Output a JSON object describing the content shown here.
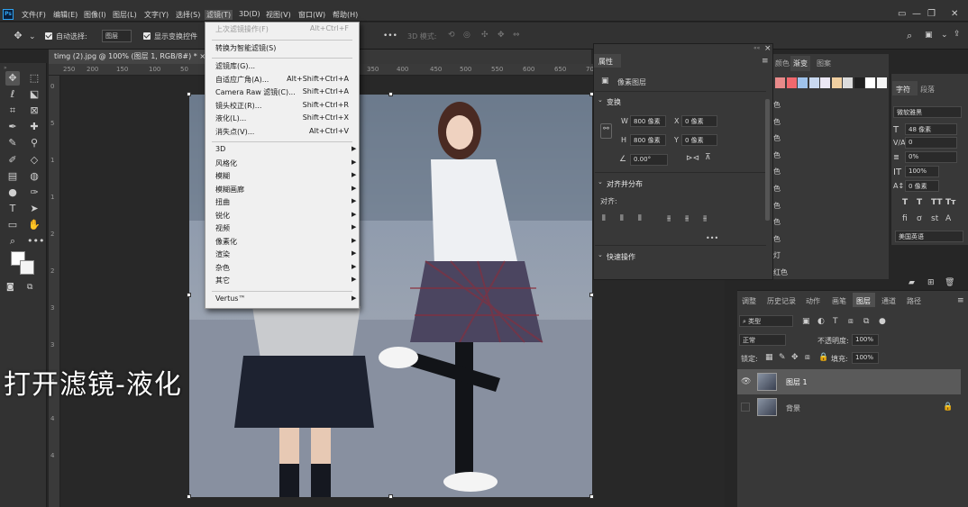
{
  "app": {
    "logo": "Ps"
  },
  "menubar": {
    "items": [
      "文件(F)",
      "编辑(E)",
      "图像(I)",
      "图层(L)",
      "文字(Y)",
      "选择(S)",
      "滤镜(T)",
      "3D(D)",
      "视图(V)",
      "窗口(W)",
      "帮助(H)"
    ],
    "active_index": 6
  },
  "options": {
    "auto_select_label": "自动选择:",
    "auto_select_value": "图层",
    "show_transform_label": "显示变换控件",
    "mode_3d_label": "3D 模式:"
  },
  "document": {
    "tab_title": "timg (2).jpg @ 100% (图层 1, RGB/8#) *",
    "tab_close": "×"
  },
  "ruler": {
    "h_ticks": [
      "250",
      "200",
      "150",
      "100",
      "50",
      "0",
      "50",
      "350",
      "400",
      "450",
      "500",
      "550",
      "600",
      "650",
      "700",
      "750"
    ],
    "v_ticks": [
      "0",
      "5",
      "1",
      "1",
      "2",
      "2",
      "3",
      "3",
      "4",
      "4",
      "4"
    ]
  },
  "filter_menu": {
    "items": [
      {
        "label": "上次滤镜操作(F)",
        "shortcut": "Alt+Ctrl+F",
        "disabled": true
      },
      {
        "sep": true
      },
      {
        "label": "转换为智能滤镜(S)",
        "shortcut": ""
      },
      {
        "sep": true
      },
      {
        "label": "滤镜库(G)...",
        "shortcut": ""
      },
      {
        "label": "自适应广角(A)...",
        "shortcut": "Alt+Shift+Ctrl+A"
      },
      {
        "label": "Camera Raw 滤镜(C)...",
        "shortcut": "Shift+Ctrl+A"
      },
      {
        "label": "镜头校正(R)...",
        "shortcut": "Shift+Ctrl+R"
      },
      {
        "label": "液化(L)...",
        "shortcut": "Shift+Ctrl+X"
      },
      {
        "label": "消失点(V)...",
        "shortcut": "Alt+Ctrl+V"
      },
      {
        "sep": true
      },
      {
        "label": "3D",
        "sub": true
      },
      {
        "label": "风格化",
        "sub": true
      },
      {
        "label": "模糊",
        "sub": true
      },
      {
        "label": "模糊画廊",
        "sub": true
      },
      {
        "label": "扭曲",
        "sub": true
      },
      {
        "label": "锐化",
        "sub": true
      },
      {
        "label": "视频",
        "sub": true
      },
      {
        "label": "像素化",
        "sub": true
      },
      {
        "label": "渲染",
        "sub": true
      },
      {
        "label": "杂色",
        "sub": true
      },
      {
        "label": "其它",
        "sub": true
      },
      {
        "sep": true
      },
      {
        "label": "Vertus™",
        "sub": true
      }
    ]
  },
  "overlay_caption": "打开滤镜-液化",
  "properties": {
    "tabs": [
      "属性"
    ],
    "layer_type": "像素图层",
    "transform_header": "变换",
    "w_label": "W",
    "w_value": "800 像素",
    "h_label": "H",
    "h_value": "800 像素",
    "x_label": "X",
    "x_value": "0 像素",
    "y_label": "Y",
    "y_value": "0 像素",
    "angle_value": "0.00°",
    "align_header": "对齐并分布",
    "align_label": "对齐:",
    "more": "•••",
    "quick_header": "快速操作"
  },
  "swatches": {
    "tabs": [
      "颜色",
      "渐变",
      "图案"
    ],
    "colors": [
      "#e88a8a",
      "#f0686e",
      "#9fc3ec",
      "#c8d8f0",
      "#ece8f5",
      "#f0cfa0",
      "#dcdcdc",
      "#202020",
      "#ffffff",
      "#f5f5f5"
    ],
    "left_labels": [
      "色",
      "色",
      "色",
      "色",
      "色",
      "色",
      "色",
      "色",
      "色",
      "灯",
      "红色"
    ]
  },
  "character": {
    "tabs": [
      "字符",
      "段落"
    ],
    "font_family": "微软雅黑",
    "font_size": "48 像素",
    "tracking": "0",
    "scale": "0%",
    "vscale": "100%",
    "baseline": "0 像素",
    "language": "美国英语"
  },
  "layers": {
    "tabs": [
      "调整",
      "历史记录",
      "动作",
      "画笔",
      "图层",
      "通道",
      "路径"
    ],
    "active_tab": 4,
    "kind_label": "类型",
    "blend_mode": "正常",
    "opacity_label": "不透明度:",
    "opacity_value": "100%",
    "lock_label": "锁定:",
    "fill_label": "填充:",
    "fill_value": "100%",
    "rows": [
      {
        "name": "图层 1",
        "visible": true,
        "selected": true
      },
      {
        "name": "背景",
        "visible": false,
        "locked": true
      }
    ]
  }
}
